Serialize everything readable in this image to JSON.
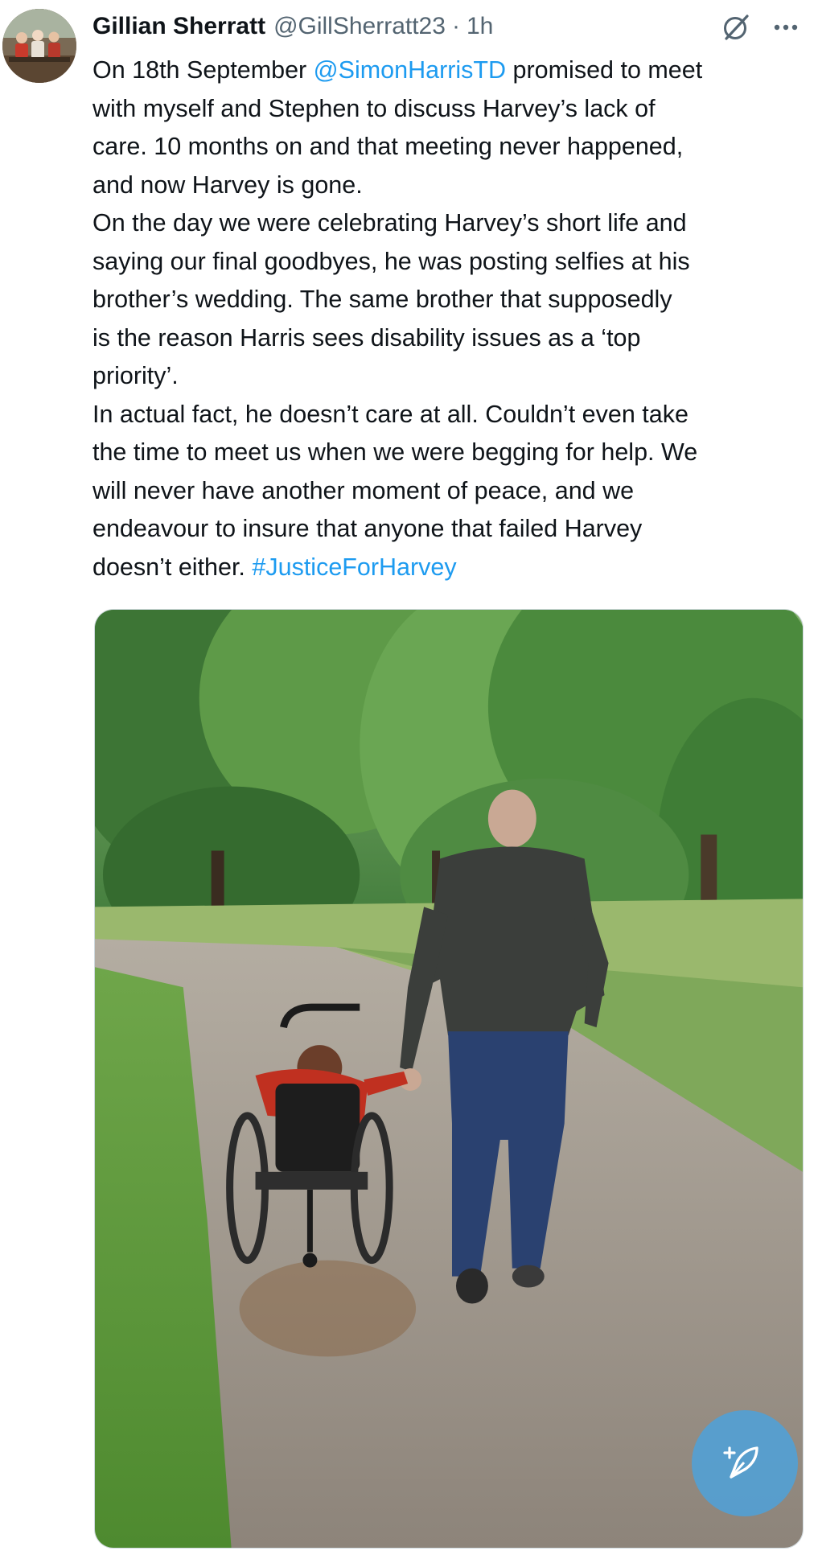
{
  "author": {
    "display_name": "Gillian Sherratt",
    "handle": "@GillSherratt23",
    "separator": "·",
    "timestamp": "1h",
    "avatar_icon": "profile-photo"
  },
  "actions": {
    "grok_icon": "grok-icon",
    "more_icon": "more-options-icon"
  },
  "tweet": {
    "lines": [
      [
        {
          "t": "On 18th September "
        },
        {
          "t": "@SimonHarrisTD",
          "link": true
        },
        {
          "t": " promised to meet"
        }
      ],
      [
        {
          "t": "with myself and Stephen to discuss Harvey’s lack of"
        }
      ],
      [
        {
          "t": "care. 10 months on and that meeting never happened,"
        }
      ],
      [
        {
          "t": "and now Harvey is gone."
        }
      ],
      [
        {
          "t": "On the day we were celebrating Harvey’s short life and"
        }
      ],
      [
        {
          "t": "saying our final goodbyes, he was posting selfies at his"
        }
      ],
      [
        {
          "t": "brother’s wedding. The same brother that supposedly"
        }
      ],
      [
        {
          "t": "is the reason Harris sees disability issues as a ‘top"
        }
      ],
      [
        {
          "t": "priority’."
        }
      ],
      [
        {
          "t": "In actual fact, he doesn’t care at all. Couldn’t even take"
        }
      ],
      [
        {
          "t": "the time to meet us when we were begging for help. We"
        }
      ],
      [
        {
          "t": "will never have another moment of peace, and we"
        }
      ],
      [
        {
          "t": "endeavour to insure that anyone that failed Harvey"
        }
      ],
      [
        {
          "t": "doesn’t either. "
        },
        {
          "t": "#JusticeForHarvey",
          "link": true
        }
      ]
    ]
  },
  "media": {
    "type": "photo",
    "icon": "photo-man-and-child-in-wheelchair-on-path"
  },
  "fab": {
    "icon": "compose-post-icon",
    "color": "#50a0d7"
  },
  "colors": {
    "text": "#0f1419",
    "secondary": "#536471",
    "link": "#1d9bf0"
  }
}
